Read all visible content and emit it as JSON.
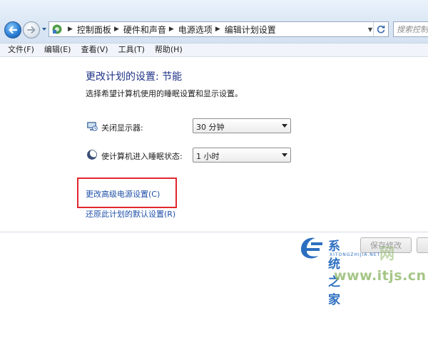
{
  "address_bar": {
    "breadcrumbs": [
      "控制面板",
      "硬件和声音",
      "电源选项",
      "编辑计划设置"
    ],
    "search_placeholder": "搜索控制..."
  },
  "menu": [
    "文件(F)",
    "编辑(E)",
    "查看(V)",
    "工具(T)",
    "帮助(H)"
  ],
  "main": {
    "title": "更改计划的设置: 节能",
    "description": "选择希望计算机使用的睡眠设置和显示设置。",
    "settings": [
      {
        "label": "关闭显示器:",
        "value": "30 分钟",
        "icon": "display-off-icon"
      },
      {
        "label": "使计算机进入睡眠状态:",
        "value": "1 小时",
        "icon": "sleep-moon-icon"
      }
    ],
    "links": {
      "advanced": "更改高级电源设置(C)",
      "restore": "还原此计划的默认设置(R)"
    },
    "buttons": {
      "save": "保存修改"
    }
  },
  "watermark": {
    "title": "系统之家",
    "subtitle": "XITONGZHIJIA.NET",
    "stamp": "网",
    "url": "www.itjs.cn"
  },
  "colors": {
    "title": "#1e3287",
    "link": "#1f4fa8",
    "highlight": "#e0272e",
    "watermark_blue": "#2c6fc0",
    "watermark_green": "#8fb86a"
  }
}
